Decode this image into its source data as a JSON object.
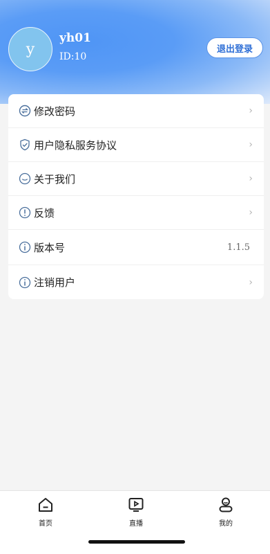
{
  "profile": {
    "avatar_letter": "y",
    "username": "yh01",
    "user_id": "ID:10",
    "logout_label": "退出登录"
  },
  "menu": [
    {
      "label": "修改密码",
      "icon": "swap-arrows-icon"
    },
    {
      "label": "用户隐私服务协议",
      "icon": "shield-check-icon"
    },
    {
      "label": "关于我们",
      "icon": "smile-icon"
    },
    {
      "label": "反馈",
      "icon": "exclamation-circle-icon"
    },
    {
      "label": "版本号",
      "icon": "info-circle-icon",
      "value": "1.1.5"
    },
    {
      "label": "注销用户",
      "icon": "info-circle-icon"
    }
  ],
  "tabs": [
    {
      "label": "首页",
      "icon": "home-icon"
    },
    {
      "label": "直播",
      "icon": "play-icon"
    },
    {
      "label": "我的",
      "icon": "user-icon"
    }
  ],
  "colors": {
    "accent": "#3b7ae8",
    "header": "#5a9cf6"
  }
}
